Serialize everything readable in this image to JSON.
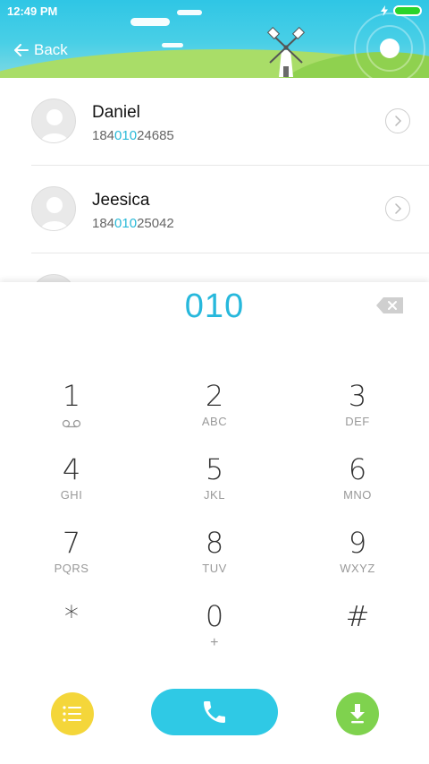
{
  "status_bar": {
    "time": "12:49 PM"
  },
  "header": {
    "back_label": "Back"
  },
  "contacts": [
    {
      "name": "Daniel",
      "number_prefix": "184",
      "number_match": "010",
      "number_suffix": "24685"
    },
    {
      "name": "Jeesica",
      "number_prefix": "184",
      "number_match": "010",
      "number_suffix": "25042"
    }
  ],
  "dialer": {
    "input": "010",
    "keys": [
      {
        "digit": "1",
        "letters": ""
      },
      {
        "digit": "2",
        "letters": "ABC"
      },
      {
        "digit": "3",
        "letters": "DEF"
      },
      {
        "digit": "4",
        "letters": "GHI"
      },
      {
        "digit": "5",
        "letters": "JKL"
      },
      {
        "digit": "6",
        "letters": "MNO"
      },
      {
        "digit": "7",
        "letters": "PQRS"
      },
      {
        "digit": "8",
        "letters": "TUV"
      },
      {
        "digit": "9",
        "letters": "WXYZ"
      },
      {
        "digit": "*",
        "letters": ""
      },
      {
        "digit": "0",
        "letters": "+"
      },
      {
        "digit": "#",
        "letters": ""
      }
    ]
  },
  "icons": {
    "back": "arrow-left-icon",
    "backspace": "backspace-icon",
    "voicemail": "voicemail-icon",
    "list": "list-icon",
    "call": "phone-icon",
    "download": "download-icon"
  },
  "colors": {
    "accent": "#29b9d8",
    "call_button": "#2fc9e5",
    "list_button": "#f4d63a",
    "download_button": "#7fd24e"
  }
}
